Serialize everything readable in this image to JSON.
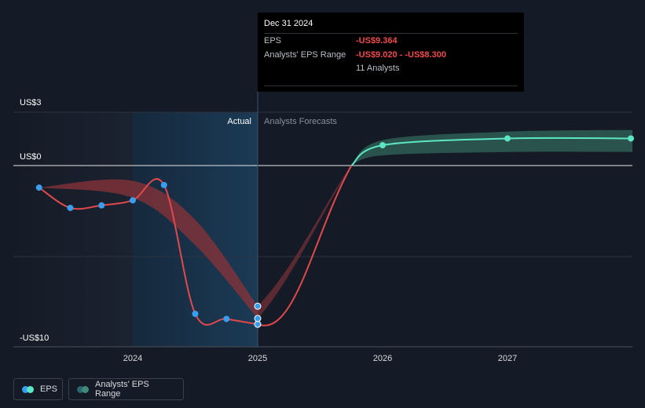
{
  "tooltip": {
    "date": "Dec 31 2024",
    "eps_label": "EPS",
    "eps_value": "-US$9.364",
    "range_label": "Analysts' EPS Range",
    "range_value": "-US$9.020 - -US$8.300",
    "analysts": "11 Analysts"
  },
  "legend": {
    "eps_label": "EPS",
    "range_label": "Analysts' EPS Range"
  },
  "colors": {
    "background": "#151b26",
    "actual_line": "#e0494b",
    "actual_band": "#8b3338",
    "forecast_line": "#5ce6c3",
    "forecast_band": "#2d5a52",
    "point": "#3a9ef0",
    "highlight": "#1b3a55"
  },
  "chart_data": {
    "type": "line",
    "y_unit": "US$",
    "ylim": [
      -10,
      3
    ],
    "y_ticks": [
      {
        "value": 3,
        "label": "US$3"
      },
      {
        "value": 0,
        "label": "US$0"
      },
      {
        "value": -10,
        "label": "-US$10"
      }
    ],
    "x_ticks": [
      {
        "value": 2024.0,
        "label": "2024"
      },
      {
        "value": 2025.0,
        "label": "2025"
      },
      {
        "value": 2026.0,
        "label": "2026"
      },
      {
        "value": 2027.0,
        "label": "2027"
      }
    ],
    "region_labels": {
      "actual": "Actual",
      "forecast": "Analysts Forecasts"
    },
    "eps_actual": [
      {
        "x": 2023.25,
        "y": -1.3
      },
      {
        "x": 2023.5,
        "y": -2.5
      },
      {
        "x": 2023.75,
        "y": -2.35
      },
      {
        "x": 2024.0,
        "y": -2.05
      },
      {
        "x": 2024.25,
        "y": -1.15
      },
      {
        "x": 2024.5,
        "y": -8.75
      },
      {
        "x": 2024.75,
        "y": -9.05
      },
      {
        "x": 2025.0,
        "y": -9.364
      }
    ],
    "actual_range": [
      {
        "x": 2023.25,
        "low": -1.3,
        "high": -1.3
      },
      {
        "x": 2024.0,
        "low": -1.9,
        "high": -0.9
      },
      {
        "x": 2024.5,
        "low": -4.7,
        "high": -3.2
      },
      {
        "x": 2025.0,
        "low": -9.02,
        "high": -8.3
      }
    ],
    "highlight_points": [
      {
        "x": 2025.0,
        "y": -8.3
      },
      {
        "x": 2025.0,
        "y": -9.02
      }
    ],
    "eps_forecast": [
      {
        "x": 2025.0,
        "y": -9.364
      },
      {
        "x": 2025.75,
        "y": 0.0
      },
      {
        "x": 2026.0,
        "y": 1.2
      },
      {
        "x": 2027.0,
        "y": 1.6
      },
      {
        "x": 2028.0,
        "y": 1.6
      }
    ],
    "forecast_range": [
      {
        "x": 2025.75,
        "low": 0.0,
        "high": 0.0
      },
      {
        "x": 2026.0,
        "low": 0.6,
        "high": 1.5
      },
      {
        "x": 2027.0,
        "low": 0.8,
        "high": 2.0
      },
      {
        "x": 2028.0,
        "low": 0.8,
        "high": 2.1
      }
    ],
    "forecast_markers": [
      2026.0,
      2027.0,
      2028.0
    ]
  }
}
